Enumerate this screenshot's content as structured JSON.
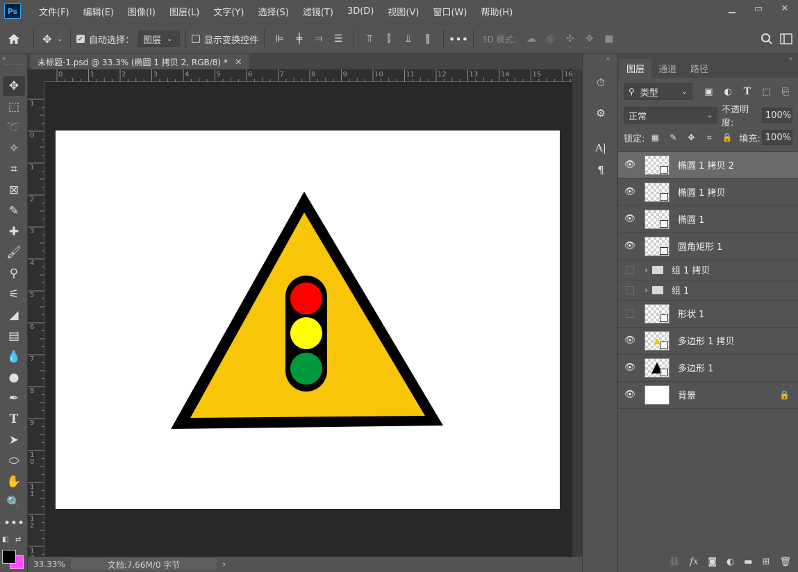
{
  "app": {
    "logo": "Ps"
  },
  "menu": [
    "文件(F)",
    "编辑(E)",
    "图像(I)",
    "图层(L)",
    "文字(Y)",
    "选择(S)",
    "滤镜(T)",
    "3D(D)",
    "视图(V)",
    "窗口(W)",
    "帮助(H)"
  ],
  "window_controls": {
    "minimize": "▁",
    "restore": "▭",
    "close": "✕"
  },
  "options": {
    "auto_select_label": "自动选择：",
    "auto_select_value": "图层",
    "show_transform_label": "显示变换控件",
    "mode_3d_label": "3D 模式："
  },
  "document": {
    "tab_title": "未标题-1.psd @ 33.3% (椭圆 1 拷贝 2, RGB/8) *",
    "close": "×",
    "ruler_top": [
      "0",
      "1",
      "2",
      "3",
      "4",
      "5",
      "6",
      "7",
      "8",
      "9",
      "10",
      "11",
      "12",
      "13",
      "14",
      "15",
      "16"
    ],
    "ruler_left": [
      "1",
      "0",
      "1",
      "2",
      "3",
      "4",
      "5",
      "6",
      "7",
      "8",
      "9",
      "10",
      "11",
      "12",
      "13"
    ]
  },
  "status": {
    "zoom": "33.33%",
    "doc_info": "文档:7.66M/0 字节",
    "arrow": "›"
  },
  "artwork": {
    "triangle_outline": "#000000",
    "triangle_fill": "#f8c508",
    "housing": "#000000",
    "lights": [
      "#ff0000",
      "#ffff00",
      "#009a3e"
    ]
  },
  "layers_panel": {
    "tabs": [
      "图层",
      "通道",
      "路径"
    ],
    "filter_label": "类型",
    "blend_mode": "正常",
    "opacity_label": "不透明度:",
    "opacity_value": "100%",
    "lock_label": "锁定:",
    "fill_label": "填充:",
    "fill_value": "100%",
    "layers": [
      {
        "name": "椭圆 1 拷贝 2",
        "visible": true,
        "selected": true
      },
      {
        "name": "椭圆 1 拷贝",
        "visible": true
      },
      {
        "name": "椭圆 1",
        "visible": true
      },
      {
        "name": "圆角矩形 1",
        "visible": true
      },
      {
        "name": "组 1 拷贝",
        "visible": false,
        "group": true
      },
      {
        "name": "组 1",
        "visible": false,
        "group": true
      },
      {
        "name": "形状 1",
        "visible": false
      },
      {
        "name": "多边形 1 拷贝",
        "visible": true
      },
      {
        "name": "多边形 1",
        "visible": true
      },
      {
        "name": "背景",
        "visible": true,
        "locked": true
      }
    ]
  },
  "middock": {
    "char_label": "A|",
    "para_label": "¶"
  }
}
